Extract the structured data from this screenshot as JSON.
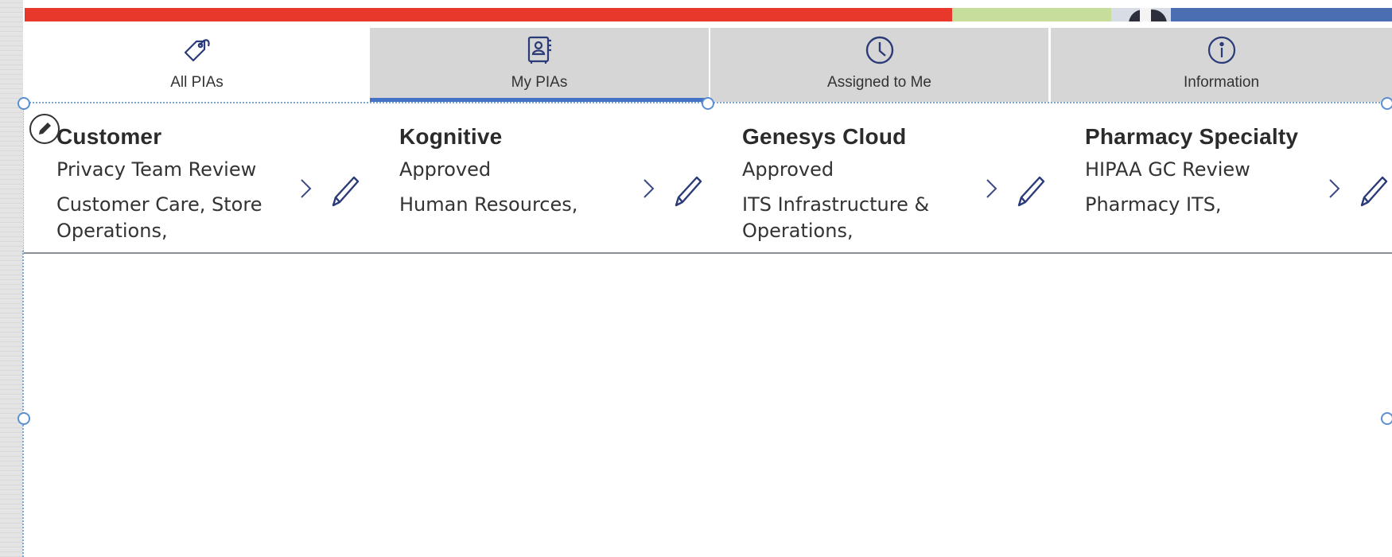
{
  "tabs": [
    {
      "label": "All PIAs",
      "icon": "tag-icon"
    },
    {
      "label": "My PIAs",
      "icon": "contact-book-icon"
    },
    {
      "label": "Assigned to Me",
      "icon": "clock-icon"
    },
    {
      "label": "Information",
      "icon": "info-icon"
    }
  ],
  "selected_tab": "My PIAs",
  "cards": [
    {
      "title": "Customer",
      "status": "Privacy Team Review",
      "department": "Customer Care, Store Operations,"
    },
    {
      "title": "Kognitive",
      "status": "Approved",
      "department": "Human Resources,"
    },
    {
      "title": "Genesys Cloud",
      "status": "Approved",
      "department": "ITS Infrastructure & Operations,"
    },
    {
      "title": "Pharmacy Specialty",
      "status": "HIPAA GC Review",
      "department": "Pharmacy ITS,"
    }
  ],
  "colors": {
    "accent_red": "#e8372b",
    "accent_green": "#c6dd9b",
    "accent_blue": "#4b6eb2",
    "tab_selected_underline": "#4472c4",
    "icon_navy": "#2a3b78"
  }
}
